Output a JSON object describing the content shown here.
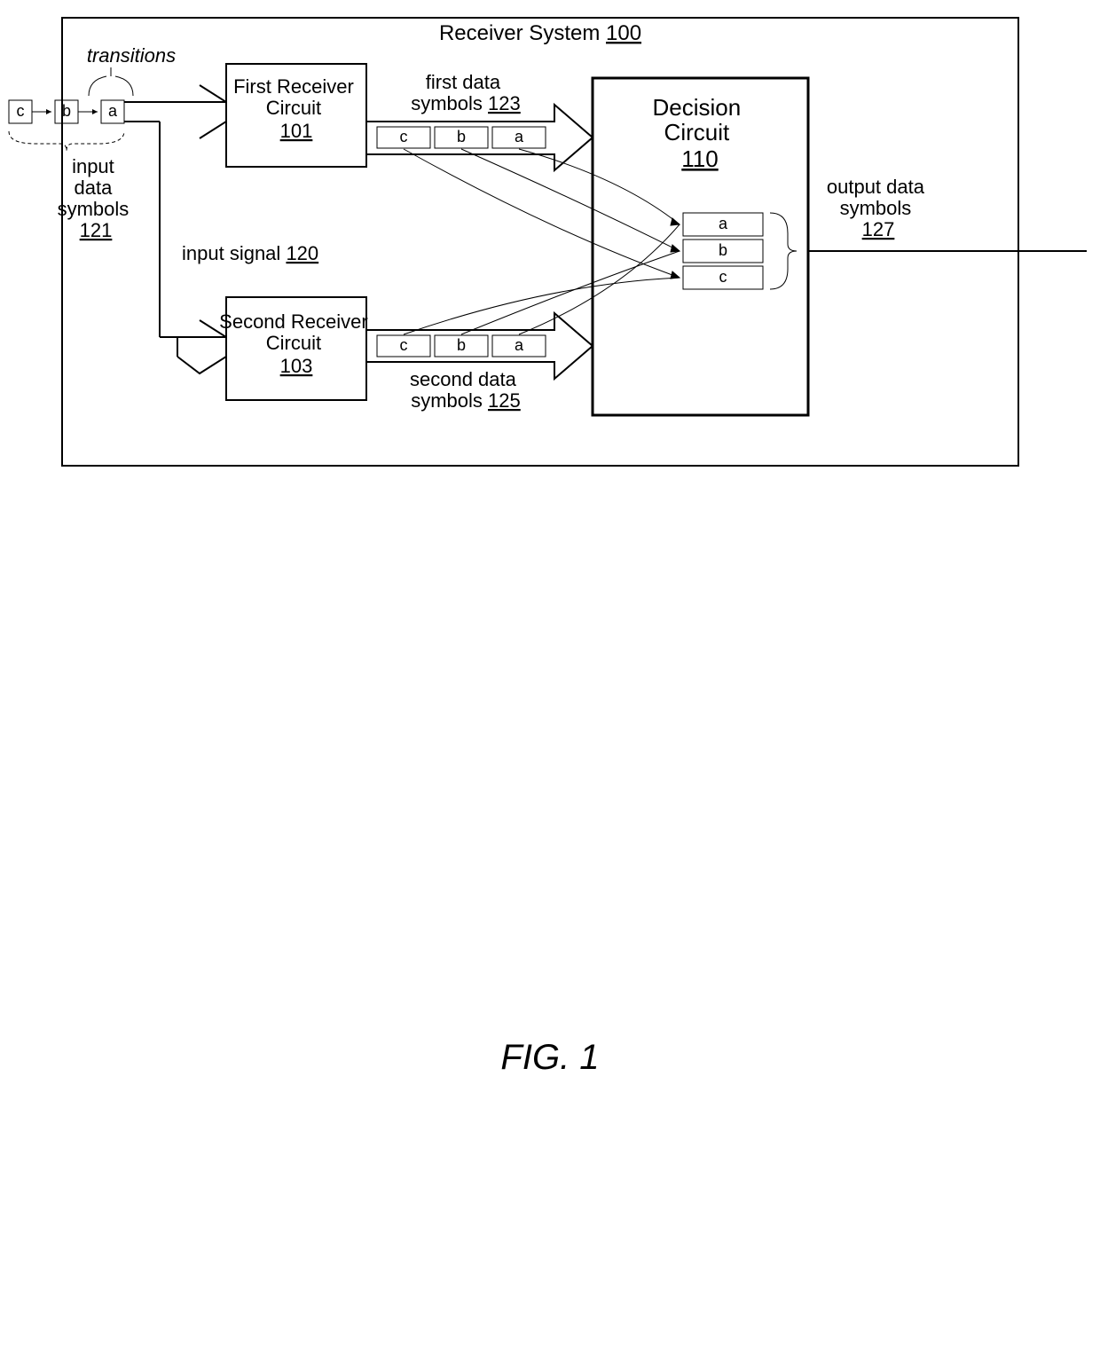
{
  "title_prefix": "Receiver System",
  "title_ref": "100",
  "transitions_label": "transitions",
  "input_symbols": {
    "line1": "input",
    "line2": "data",
    "line3": "symbols",
    "ref": "121",
    "cells": [
      "c",
      "b",
      "a"
    ]
  },
  "input_signal": {
    "prefix": "input signal",
    "ref": "120"
  },
  "receiver1": {
    "line1": "First Receiver",
    "line2": "Circuit",
    "ref": "101"
  },
  "receiver2": {
    "line1": "Second Receiver",
    "line2": "Circuit",
    "ref": "103"
  },
  "first_data": {
    "line1": "first data",
    "line2_prefix": "symbols",
    "line2_ref": "123",
    "cells": [
      "c",
      "b",
      "a"
    ]
  },
  "second_data": {
    "line1": "second data",
    "line2_prefix": "symbols",
    "line2_ref": "125",
    "cells": [
      "c",
      "b",
      "a"
    ]
  },
  "decision": {
    "line1": "Decision",
    "line2": "Circuit",
    "ref": "110",
    "cells": [
      "a",
      "b",
      "c"
    ]
  },
  "output": {
    "line1": "output data",
    "line2": "symbols",
    "ref": "127"
  },
  "figure": "FIG. 1"
}
